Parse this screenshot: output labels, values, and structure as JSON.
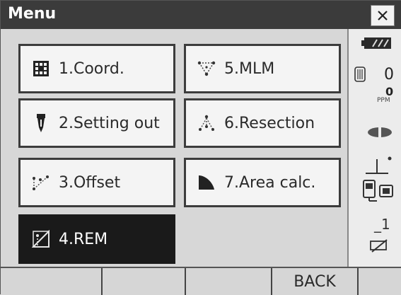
{
  "window": {
    "title": "Menu",
    "close_icon": "close-icon"
  },
  "menu": {
    "items": [
      {
        "label": "1.Coord.",
        "icon": "grid-coord-icon",
        "selected": false
      },
      {
        "label": "2.Setting out",
        "icon": "stake-icon",
        "selected": false
      },
      {
        "label": "3.Offset",
        "icon": "offset-icon",
        "selected": false
      },
      {
        "label": "4.REM",
        "icon": "rem-icon",
        "selected": true
      },
      {
        "label": "5.MLM",
        "icon": "mlm-icon",
        "selected": false
      },
      {
        "label": "6.Resection",
        "icon": "resection-icon",
        "selected": false
      },
      {
        "label": "7.Area calc.",
        "icon": "area-icon",
        "selected": false
      }
    ]
  },
  "status": {
    "battery_icon": "battery-icon",
    "target_value": "0",
    "ppm_value": "0",
    "ppm_unit": "PPM",
    "laser_icon": "laser-icon",
    "tilt_icon": "tilt-icon",
    "comm_icon": "communication-icon",
    "input_mode": "_1",
    "sip_icon": "keyboard-icon"
  },
  "softkeys": {
    "labels": [
      "",
      "",
      "",
      "BACK",
      ""
    ]
  },
  "colors": {
    "title_bar": "#3b3b3b",
    "selected_bg": "#1a1a1a",
    "button_bg": "#f4f4f4"
  }
}
